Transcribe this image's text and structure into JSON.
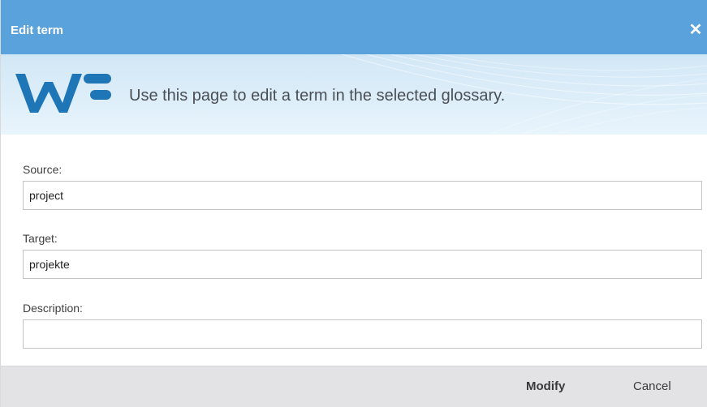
{
  "dialog": {
    "title": "Edit term",
    "close_icon": "close-icon"
  },
  "banner": {
    "logo_text": "WF",
    "message": "Use this page to edit a term in the selected glossary."
  },
  "form": {
    "source_label": "Source:",
    "source_value": "project",
    "target_label": "Target:",
    "target_value": "projekte",
    "description_label": "Description:",
    "description_value": ""
  },
  "footer": {
    "modify_label": "Modify",
    "cancel_label": "Cancel"
  },
  "colors": {
    "titlebar": "#5aa2dc",
    "logo": "#1f76b7",
    "footer": "#e3e3e5"
  }
}
